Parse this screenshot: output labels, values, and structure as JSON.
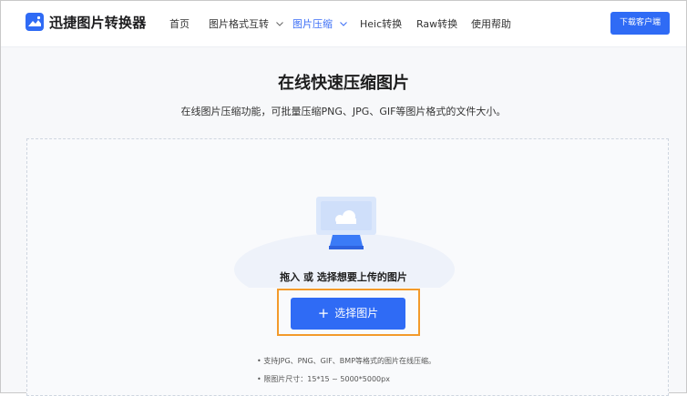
{
  "header": {
    "brand": "迅捷图片转换器",
    "nav": {
      "home": "首页",
      "format_convert": "图片格式互转",
      "compress": "图片压缩",
      "heic": "Heic转换",
      "raw": "Raw转换",
      "help": "使用帮助"
    },
    "download_button": "下载客户端"
  },
  "main": {
    "title": "在线快速压缩图片",
    "subtitle": "在线图片压缩功能，可批量压缩PNG、JPG、GIF等图片格式的文件大小。",
    "drop_hint": "拖入 或 选择想要上传的图片",
    "select_button": "选择图片",
    "notes": [
      "• 支持JPG、PNG、GIF、BMP等格式的图片在线压缩。",
      "• 限图片尺寸：15*15 ~ 5000*5000px"
    ]
  },
  "colors": {
    "accent": "#2f6bf5",
    "focus_outline": "#f39a2b"
  },
  "icons": {
    "logo": "image-logo-icon",
    "chevron": "chevron-down-icon",
    "plus": "plus-icon",
    "illustration": "upload-image-illustration"
  }
}
